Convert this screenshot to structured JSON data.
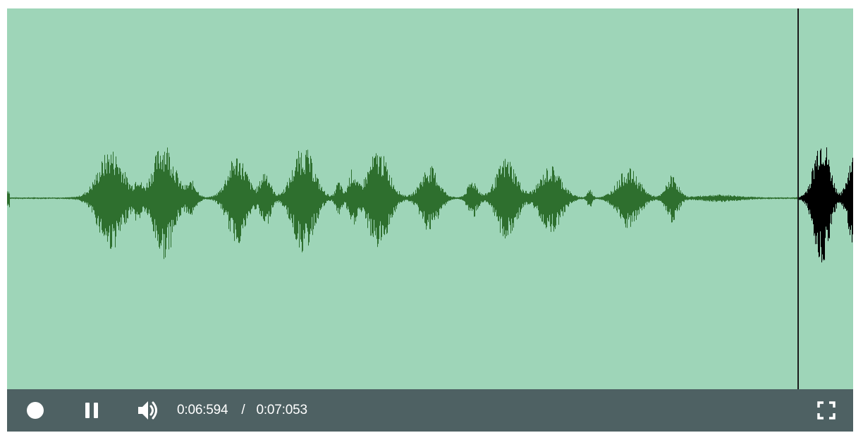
{
  "player": {
    "colors": {
      "background": "#9ed5b8",
      "wave_played": "#2e6f2e",
      "wave_unplayed": "#000000",
      "cursor": "#1a1a1a",
      "control_bar": "#4e6163",
      "control_icons": "#ffffff"
    },
    "playback": {
      "current_time": "0:06:594",
      "separator": "/",
      "total_time": "0:07:053",
      "progress": 0.9349
    },
    "controls": {
      "record_icon": "record-circle-icon",
      "pause_icon": "pause-icon",
      "volume_icon": "speaker-volume-icon",
      "fullscreen_icon": "fullscreen-icon"
    }
  }
}
